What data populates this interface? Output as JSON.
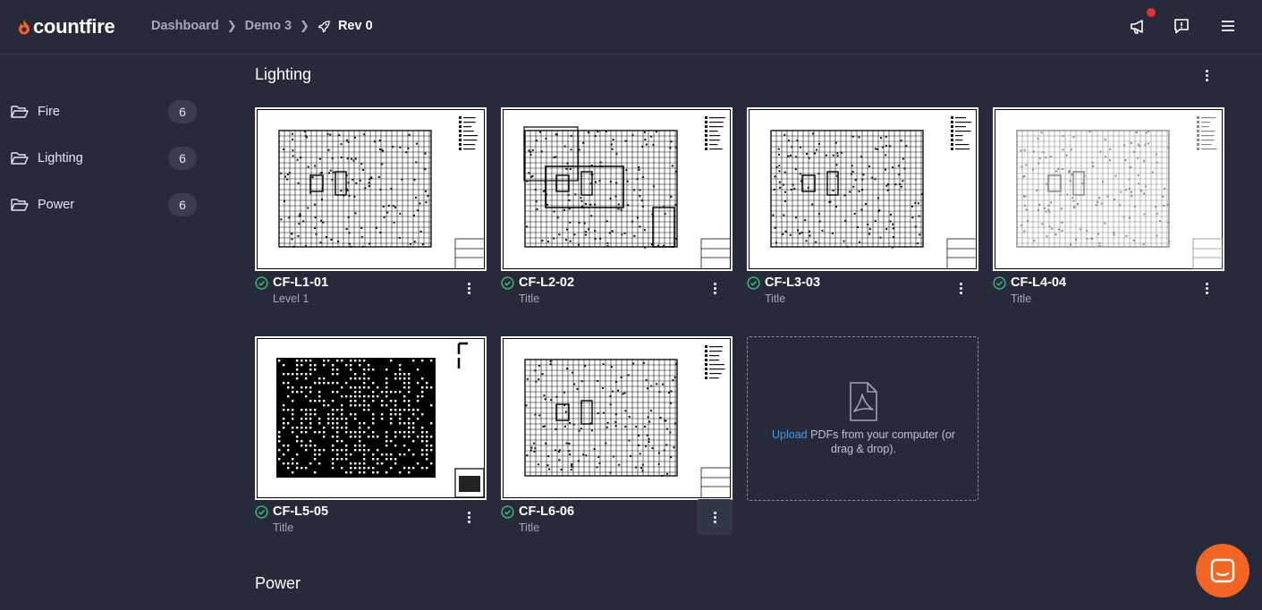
{
  "brand": {
    "name": "countfire",
    "accent": "#f26522"
  },
  "breadcrumb": {
    "items": [
      "Dashboard",
      "Demo 3"
    ],
    "current": "Rev 0"
  },
  "header_icons": [
    "megaphone-icon",
    "feedback-icon",
    "hamburger-menu-icon"
  ],
  "sidebar": {
    "items": [
      {
        "label": "Fire",
        "count": "6"
      },
      {
        "label": "Lighting",
        "count": "6"
      },
      {
        "label": "Power",
        "count": "6"
      }
    ]
  },
  "sections": {
    "lighting": {
      "title": "Lighting"
    },
    "power": {
      "title": "Power"
    }
  },
  "drawings": [
    {
      "name": "CF-L1-01",
      "subtitle": "Level 1"
    },
    {
      "name": "CF-L2-02",
      "subtitle": "Title"
    },
    {
      "name": "CF-L3-03",
      "subtitle": "Title"
    },
    {
      "name": "CF-L4-04",
      "subtitle": "Title"
    },
    {
      "name": "CF-L5-05",
      "subtitle": "Title"
    },
    {
      "name": "CF-L6-06",
      "subtitle": "Title"
    }
  ],
  "upload": {
    "link_text": "Upload",
    "text": "PDFs from your computer (or drag & drop)."
  },
  "colors": {
    "status_ok": "#3fbf75",
    "link": "#3aa0e8",
    "background": "#262a3a"
  }
}
